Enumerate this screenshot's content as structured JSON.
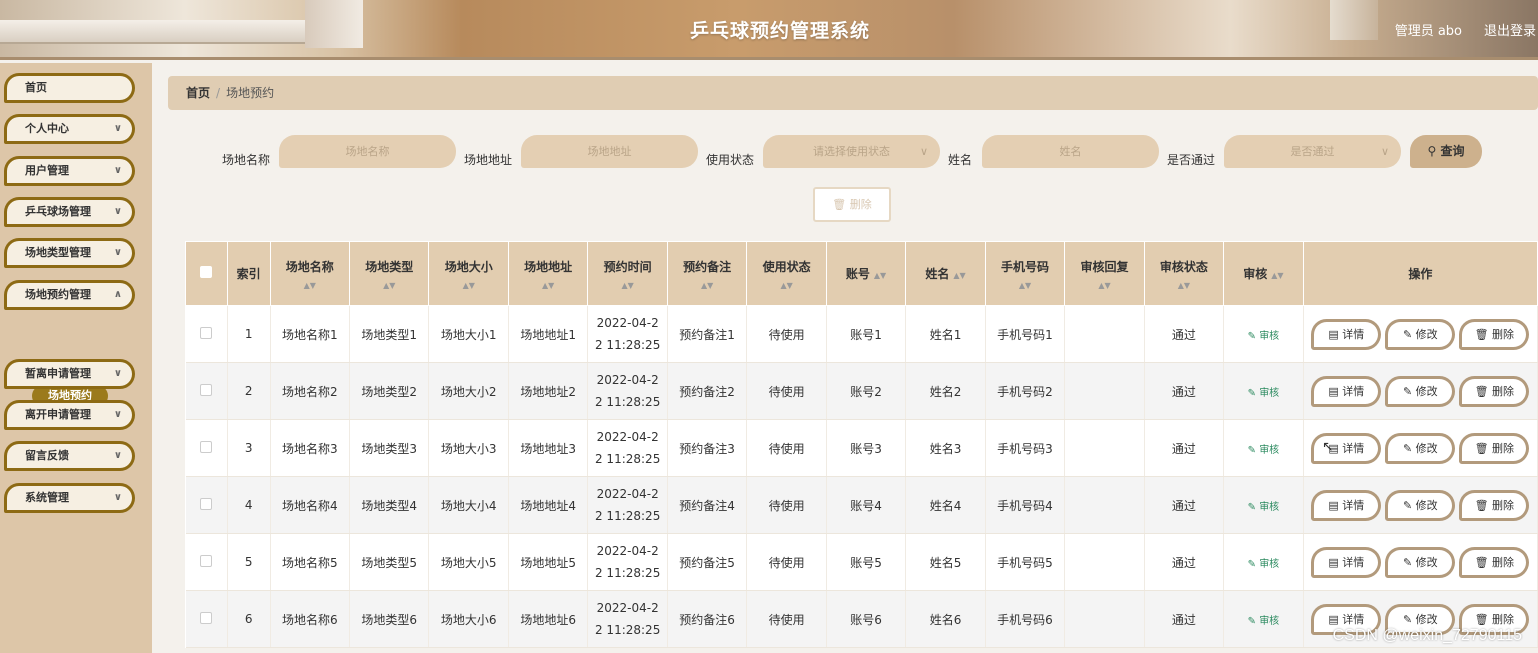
{
  "header": {
    "title": "乒乓球预约管理系统",
    "user": "管理员 abo",
    "logout": "退出登录"
  },
  "sidebar": {
    "items": [
      {
        "label": "首页",
        "has_chevron": false
      },
      {
        "label": "个人中心",
        "has_chevron": true
      },
      {
        "label": "用户管理",
        "has_chevron": true
      },
      {
        "label": "乒乓球场管理",
        "has_chevron": true
      },
      {
        "label": "场地类型管理",
        "has_chevron": true
      },
      {
        "label": "场地预约管理",
        "has_chevron": true
      },
      {
        "label": "暂离申请管理",
        "has_chevron": true
      },
      {
        "label": "离开申请管理",
        "has_chevron": true
      },
      {
        "label": "留言反馈",
        "has_chevron": true
      },
      {
        "label": "系统管理",
        "has_chevron": true
      }
    ],
    "submenu_active": "场地预约"
  },
  "breadcrumb": {
    "home": "首页",
    "separator": "/",
    "current": "场地预约"
  },
  "search": {
    "name_label": "场地名称",
    "name_placeholder": "场地名称",
    "address_label": "场地地址",
    "address_placeholder": "场地地址",
    "status_label": "使用状态",
    "status_placeholder": "请选择使用状态",
    "person_label": "姓名",
    "person_placeholder": "姓名",
    "pass_label": "是否通过",
    "pass_placeholder": "是否通过",
    "search_button": "查询",
    "delete_button": "删除"
  },
  "table": {
    "headers": [
      "索引",
      "场地名称",
      "场地类型",
      "场地大小",
      "场地地址",
      "预约时间",
      "预约备注",
      "使用状态",
      "账号",
      "姓名",
      "手机号码",
      "审核回复",
      "审核状态",
      "审核",
      "操作"
    ],
    "rows": [
      {
        "index": "1",
        "name": "场地名称1",
        "type": "场地类型1",
        "size": "场地大小1",
        "address": "场地地址1",
        "time": "2022-04-2\n2 11:28:25",
        "remark": "预约备注1",
        "status": "待使用",
        "account": "账号1",
        "person": "姓名1",
        "phone": "手机号码1",
        "reply": "",
        "audit_status": "通过"
      },
      {
        "index": "2",
        "name": "场地名称2",
        "type": "场地类型2",
        "size": "场地大小2",
        "address": "场地地址2",
        "time": "2022-04-2\n2 11:28:25",
        "remark": "预约备注2",
        "status": "待使用",
        "account": "账号2",
        "person": "姓名2",
        "phone": "手机号码2",
        "reply": "",
        "audit_status": "通过"
      },
      {
        "index": "3",
        "name": "场地名称3",
        "type": "场地类型3",
        "size": "场地大小3",
        "address": "场地地址3",
        "time": "2022-04-2\n2 11:28:25",
        "remark": "预约备注3",
        "status": "待使用",
        "account": "账号3",
        "person": "姓名3",
        "phone": "手机号码3",
        "reply": "",
        "audit_status": "通过"
      },
      {
        "index": "4",
        "name": "场地名称4",
        "type": "场地类型4",
        "size": "场地大小4",
        "address": "场地地址4",
        "time": "2022-04-2\n2 11:28:25",
        "remark": "预约备注4",
        "status": "待使用",
        "account": "账号4",
        "person": "姓名4",
        "phone": "手机号码4",
        "reply": "",
        "audit_status": "通过"
      },
      {
        "index": "5",
        "name": "场地名称5",
        "type": "场地类型5",
        "size": "场地大小5",
        "address": "场地地址5",
        "time": "2022-04-2\n2 11:28:25",
        "remark": "预约备注5",
        "status": "待使用",
        "account": "账号5",
        "person": "姓名5",
        "phone": "手机号码5",
        "reply": "",
        "audit_status": "通过"
      },
      {
        "index": "6",
        "name": "场地名称6",
        "type": "场地类型6",
        "size": "场地大小6",
        "address": "场地地址6",
        "time": "2022-04-2\n2 11:28:25",
        "remark": "预约备注6",
        "status": "待使用",
        "account": "账号6",
        "person": "姓名6",
        "phone": "手机号码6",
        "reply": "",
        "audit_status": "通过"
      }
    ],
    "audit_link": "审核",
    "actions": {
      "detail": "详情",
      "edit": "修改",
      "delete": "删除"
    }
  },
  "watermark": "CSDN @weixin_72790115",
  "colors": {
    "accent": "#8d6a14",
    "header_row": "#e2cdb0",
    "sidebar": "#ddc6a8",
    "audit_link": "#2b8a5f"
  }
}
